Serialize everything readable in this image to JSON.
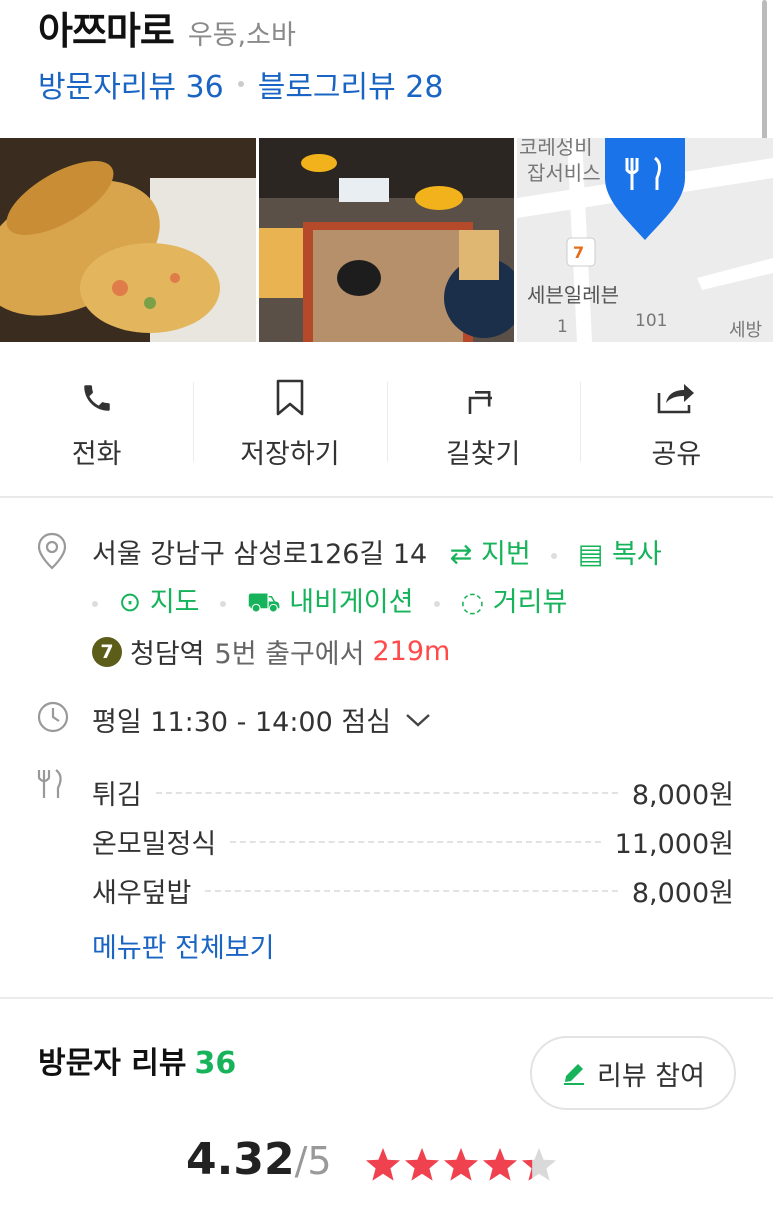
{
  "place": {
    "name": "아쯔마로",
    "category": "우동,소바",
    "visitor_reviews_link": "방문자리뷰 36",
    "blog_reviews_link": "블로그리뷰 28"
  },
  "map_thumb": {
    "label_top1": "코레성비",
    "label_top2": "잡서비스",
    "store_name": "세븐일레븐",
    "num1": "1",
    "num2": "101",
    "label_right": "세방"
  },
  "actions": [
    {
      "label": "전화",
      "icon": "phone-icon"
    },
    {
      "label": "저장하기",
      "icon": "bookmark-icon"
    },
    {
      "label": "길찾기",
      "icon": "directions-icon"
    },
    {
      "label": "공유",
      "icon": "share-icon"
    }
  ],
  "address": {
    "text": "서울 강남구 삼성로126길 14",
    "jibun": "지번",
    "copy": "복사",
    "map": "지도",
    "navigation": "내비게이션",
    "street_view": "거리뷰"
  },
  "subway": {
    "line": "7",
    "line_color": "#5b5d18",
    "station": "청담역",
    "exit": "5번 출구에서",
    "distance": "219m"
  },
  "hours": {
    "text": "평일 11:30 - 14:00 점심"
  },
  "menu": {
    "items": [
      {
        "name": "튀김",
        "price": "8,000원"
      },
      {
        "name": "온모밀정식",
        "price": "11,000원"
      },
      {
        "name": "새우덮밥",
        "price": "8,000원"
      }
    ],
    "view_all": "메뉴판 전체보기"
  },
  "visitor_reviews": {
    "title": "방문자 리뷰",
    "count": "36",
    "write_button": "리뷰 참여",
    "score": "4.32",
    "out_of": "/5",
    "rating_value": 4.32
  },
  "colors": {
    "accent_green": "#16b35a",
    "link_blue": "#1a64c4",
    "star_red": "#f0424e",
    "distance_red": "#ff4a4a"
  }
}
